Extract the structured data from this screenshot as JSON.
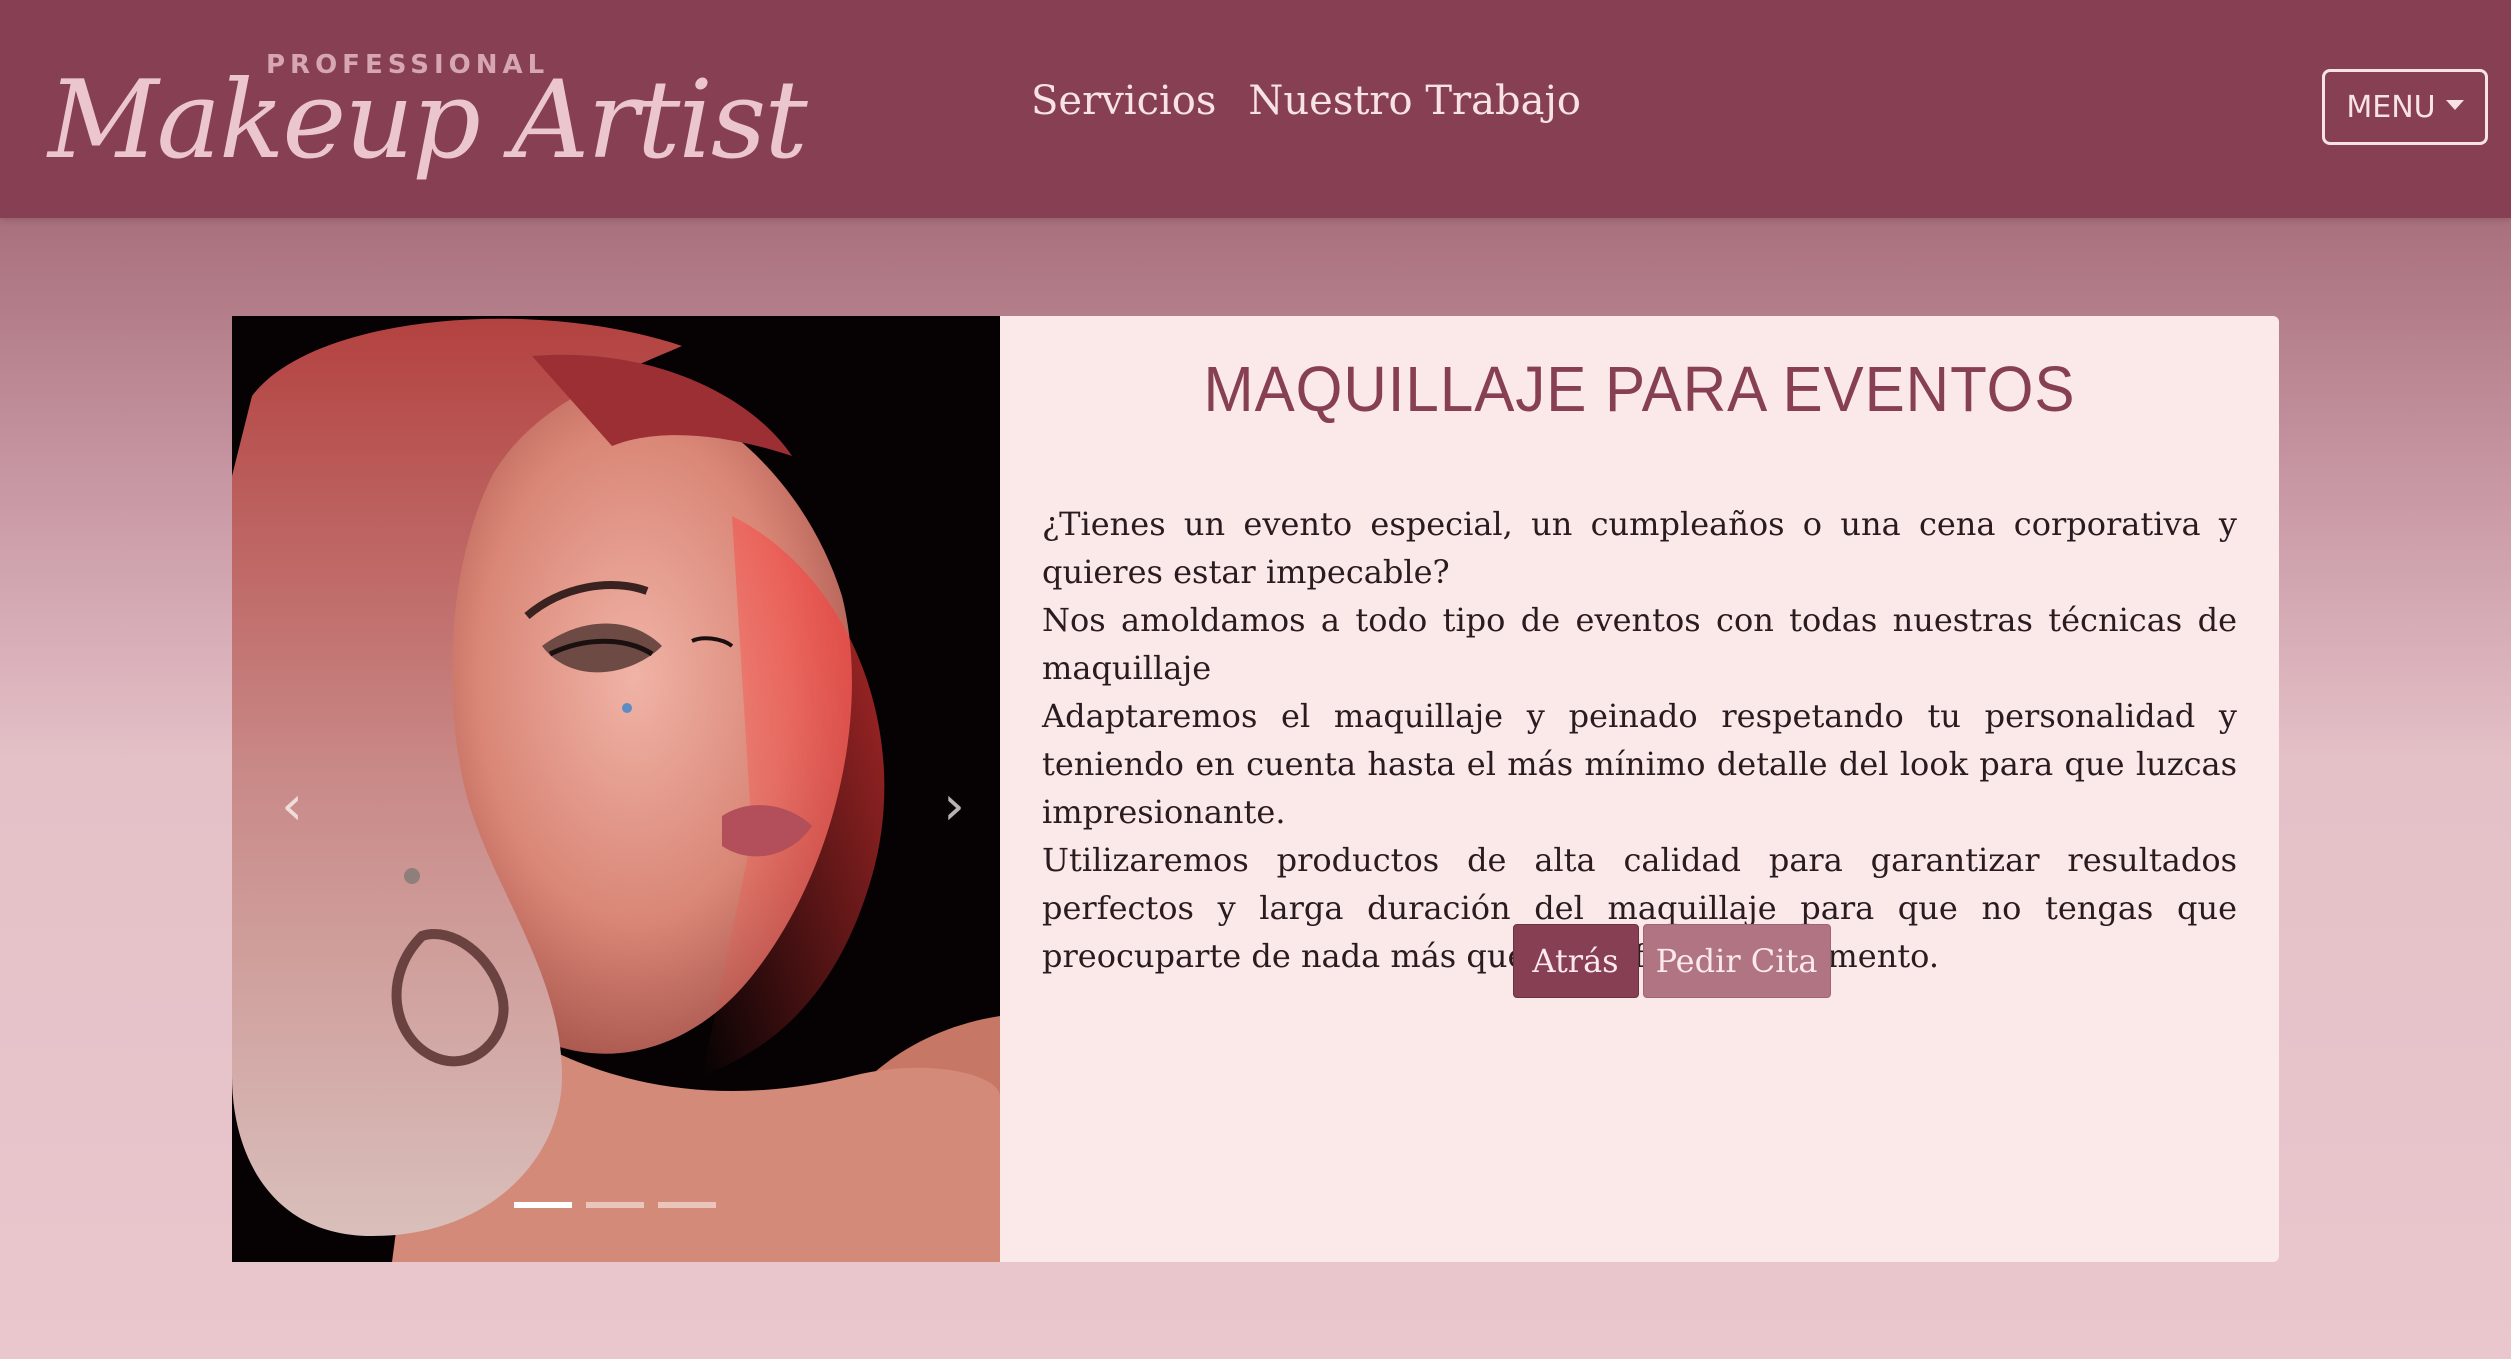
{
  "header": {
    "logo": {
      "small_text": "PROFESSIONAL",
      "script_text": "Makeup Artist"
    },
    "nav": [
      {
        "label": "Servicios"
      },
      {
        "label": "Nuestro Trabajo"
      }
    ],
    "menu_label": "MENU"
  },
  "carousel": {
    "prev_icon": "chevron-left-icon",
    "next_icon": "chevron-right-icon",
    "prev_glyph": "‹",
    "next_glyph": "›",
    "slide_count": 3,
    "active_index": 0
  },
  "service": {
    "title": "MAQUILLAJE PARA EVENTOS",
    "paragraphs": [
      "¿Tienes un evento especial, un cumpleaños o una cena corporativa y quieres estar impecable?",
      "Nos amoldamos a todo tipo de eventos con todas nuestras técnicas de maquillaje",
      "Adaptaremos el maquillaje y peinado respetando tu personalidad y teniendo en cuenta hasta el más mínimo detalle del look para que luzcas impresionante.",
      "Utilizaremos productos de alta calidad para garantizar resultados perfectos y larga duración del maquillaje para que no tengas que preocuparte de nada más que de disfrutar el momento."
    ],
    "back_button": "Atrás",
    "appointment_button": "Pedir Cita"
  },
  "colors": {
    "brand": "#873f53",
    "brand_light": "#b07482",
    "card_bg": "#fae9e8",
    "page_bg": "#e9c7cd"
  }
}
